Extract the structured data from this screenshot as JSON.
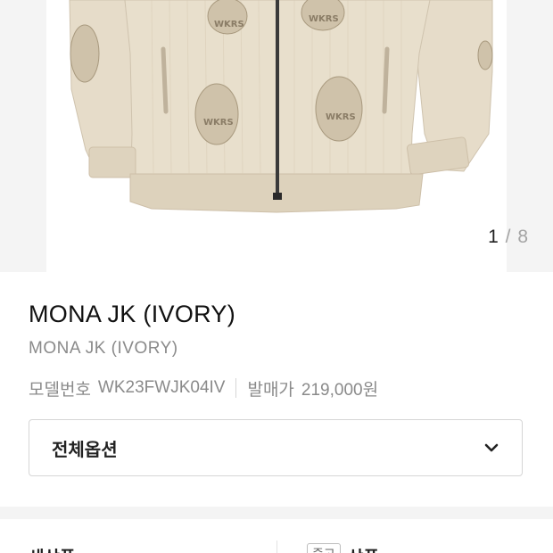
{
  "gallery": {
    "image_alt": "Ivory corduroy zip jacket with embroidered patches",
    "current": "1",
    "separator": "/",
    "total": "8"
  },
  "product": {
    "title": "MONA JK (IVORY)",
    "subtitle": "MONA JK (IVORY)",
    "model_label": "모델번호",
    "model_number": "WK23FWJK04IV",
    "release_price_label": "발매가",
    "release_price": "219,000원"
  },
  "options": {
    "label": "전체옵션",
    "icon": "chevron-down-icon"
  },
  "tabs": {
    "new_label": "새상품",
    "used_badge": "중고",
    "used_label": "상품"
  },
  "colors": {
    "jacket": "#e6dcc9",
    "background": "#f4f4f4",
    "text_primary": "#222222",
    "text_secondary": "#8a8a8a"
  }
}
